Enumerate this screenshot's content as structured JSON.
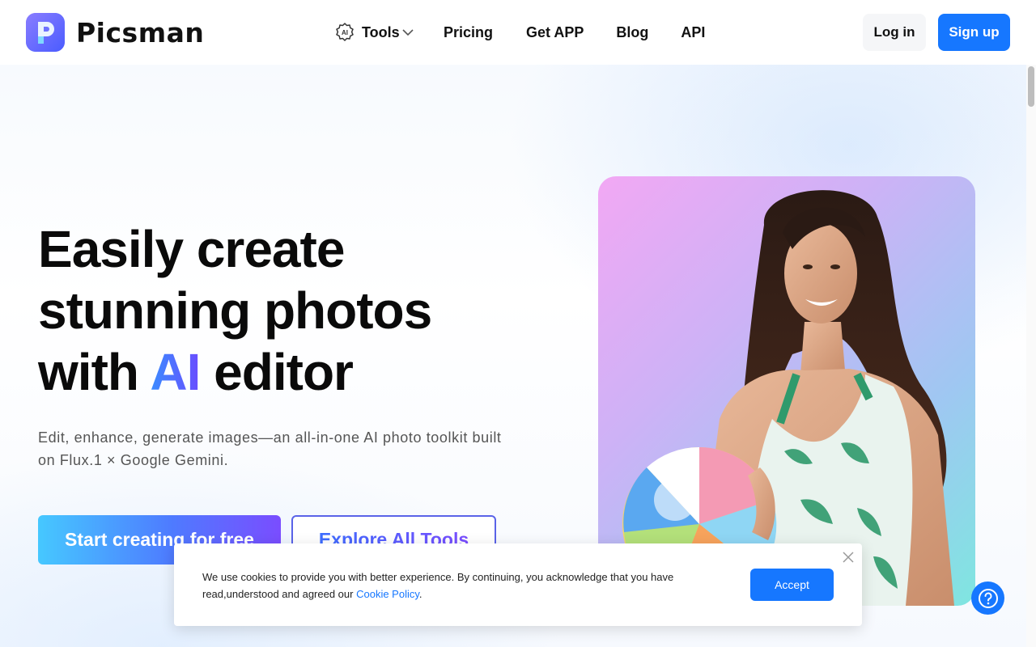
{
  "brand": {
    "name": "Picsman",
    "logo_letter": "P"
  },
  "nav": {
    "items": [
      {
        "label": "Tools"
      },
      {
        "label": "Pricing"
      },
      {
        "label": "Get APP"
      },
      {
        "label": "Blog"
      },
      {
        "label": "API"
      }
    ],
    "tools_badge": "AI"
  },
  "auth": {
    "login_label": "Log in",
    "signup_label": "Sign up"
  },
  "hero": {
    "headline_line1": "Easily create",
    "headline_line2": "stunning photos",
    "headline_with": "with",
    "headline_ai": "AI",
    "headline_editor": "editor",
    "subtitle": "Edit, enhance, generate images—an all-in-one AI photo toolkit built on Flux.1 × Google Gemini.",
    "primary_cta": "Start creating for free",
    "secondary_cta": "Explore All Tools"
  },
  "cookie": {
    "text_before": "We use cookies to provide you with better experience. By continuing, you acknowledge that you have read,understood and agreed our ",
    "link_label": "Cookie Policy",
    "text_after": ".",
    "accept_label": "Accept"
  },
  "colors": {
    "accent": "#1677ff",
    "gradient_start": "#46c8ff",
    "gradient_end": "#7a4dff"
  },
  "icons": {
    "tools": "ai-chip-icon",
    "chevron": "chevron-down-icon",
    "close": "close-icon",
    "help": "question-icon"
  }
}
